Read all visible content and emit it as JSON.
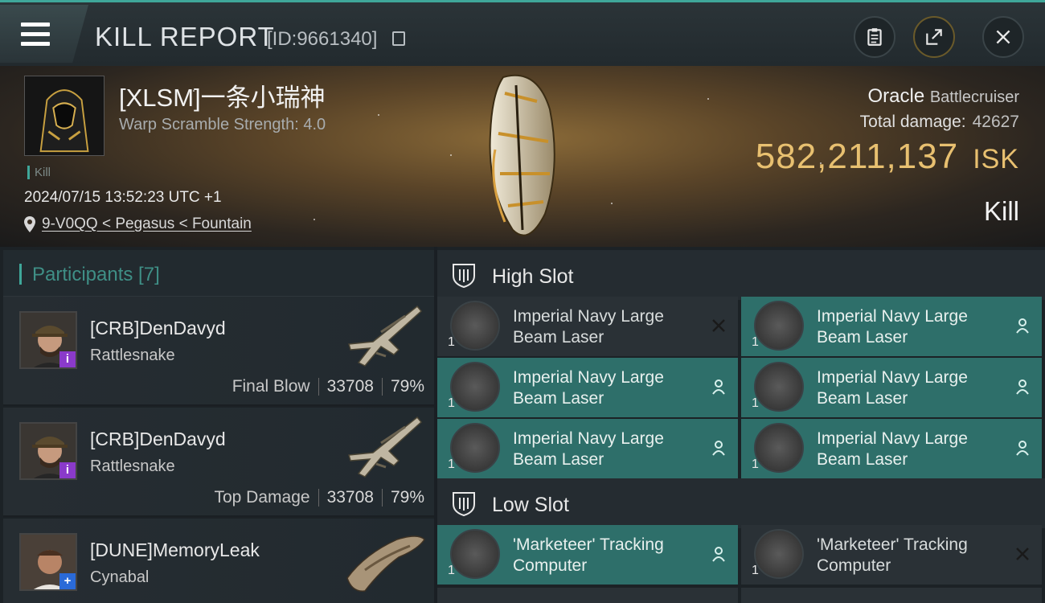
{
  "header": {
    "title": "KILL REPORT",
    "id_text": "[ID:9661340]"
  },
  "victim": {
    "pilot_name": "[XLSM]一条小瑞神",
    "warp_scramble": "Warp Scramble Strength: 4.0",
    "kill_label": "Kill",
    "datetime": "2024/07/15 13:52:23 UTC +1",
    "location": "9-V0QQ < Pegasus < Fountain",
    "ship_name": "Oracle",
    "ship_class": "Battlecruiser",
    "total_damage_label": "Total damage:",
    "total_damage_value": "42627",
    "isk_value": "582,211,137",
    "isk_unit": "ISK",
    "result": "Kill"
  },
  "participants": {
    "label": "Participants [7]",
    "rows": [
      {
        "name": "[CRB]DenDavyd",
        "ship": "Rattlesnake",
        "tag": "Final Blow",
        "damage": "33708",
        "percent": "79%",
        "badge": "i"
      },
      {
        "name": "[CRB]DenDavyd",
        "ship": "Rattlesnake",
        "tag": "Top Damage",
        "damage": "33708",
        "percent": "79%",
        "badge": "i"
      },
      {
        "name": "[DUNE]MemoryLeak",
        "ship": "Cynabal",
        "tag": "",
        "damage": "",
        "percent": "",
        "badge": "+"
      }
    ]
  },
  "high_slot": {
    "label": "High Slot",
    "modules": [
      {
        "name_line1": "Imperial Navy Large",
        "name_line2": "Beam Laser",
        "qty": "1",
        "status": "destroyed"
      },
      {
        "name_line1": "Imperial Navy Large",
        "name_line2": "Beam Laser",
        "qty": "1",
        "status": "dropped"
      },
      {
        "name_line1": "Imperial Navy Large",
        "name_line2": "Beam Laser",
        "qty": "1",
        "status": "dropped"
      },
      {
        "name_line1": "Imperial Navy Large",
        "name_line2": "Beam Laser",
        "qty": "1",
        "status": "dropped"
      },
      {
        "name_line1": "Imperial Navy Large",
        "name_line2": "Beam Laser",
        "qty": "1",
        "status": "dropped"
      },
      {
        "name_line1": "Imperial Navy Large",
        "name_line2": "Beam Laser",
        "qty": "1",
        "status": "dropped"
      }
    ]
  },
  "low_slot": {
    "label": "Low Slot",
    "modules": [
      {
        "name_line1": "'Marketeer' Tracking",
        "name_line2": "Computer",
        "qty": "1",
        "status": "dropped"
      },
      {
        "name_line1": "'Marketeer' Tracking",
        "name_line2": "Computer",
        "qty": "1",
        "status": "destroyed"
      }
    ]
  },
  "colors": {
    "accent_teal": "#3fa79a",
    "isk_gold": "#e8c070",
    "active_module": "#2e6f6a"
  }
}
